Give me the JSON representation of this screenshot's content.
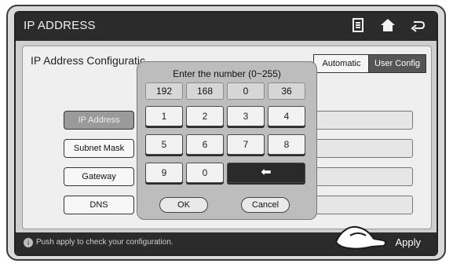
{
  "header": {
    "title": "IP ADDRESS",
    "icons": [
      "document-icon",
      "home-icon",
      "back-icon"
    ]
  },
  "panel": {
    "title": "IP Address Configuratic",
    "mode_auto": "Automatic",
    "mode_user": "User Config"
  },
  "left_buttons": [
    {
      "label": "IP Address",
      "active": true
    },
    {
      "label": "Subnet Mask",
      "active": false
    },
    {
      "label": "Gateway",
      "active": false
    },
    {
      "label": "DNS",
      "active": false
    }
  ],
  "keypad": {
    "prompt": "Enter the number (0~255)",
    "octets": [
      "192",
      "168",
      "0",
      "36"
    ],
    "keys": [
      "1",
      "2",
      "3",
      "4",
      "5",
      "6",
      "7",
      "8",
      "9",
      "0"
    ],
    "backspace_label": "⬅",
    "ok": "OK",
    "cancel": "Cancel"
  },
  "footer": {
    "hint": "Push apply to check your configuration.",
    "apply": "Apply",
    "info_icon": "i"
  }
}
